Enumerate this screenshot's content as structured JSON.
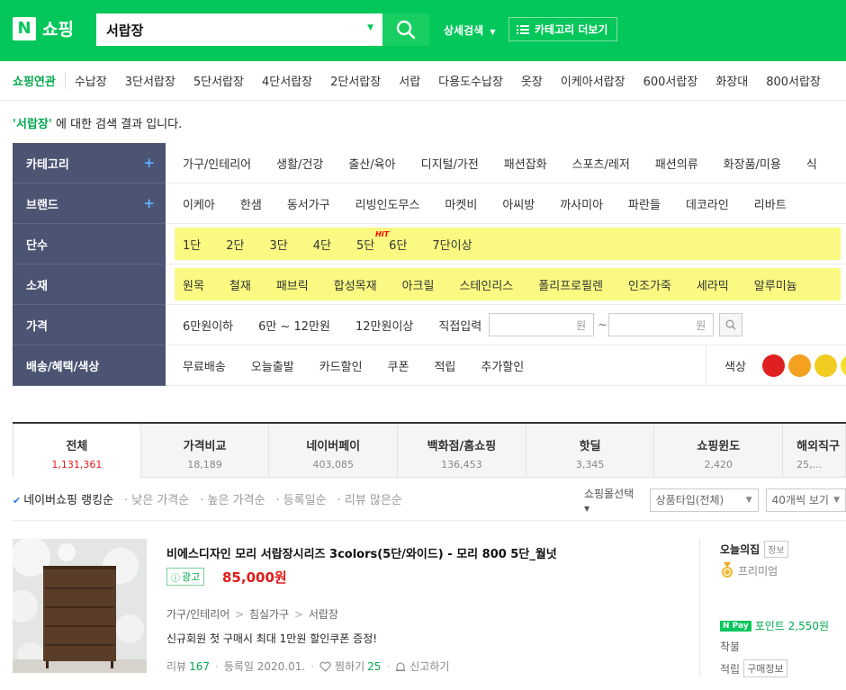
{
  "header": {
    "logo_letter": "N",
    "logo_text": "쇼핑",
    "search_value": "서랍장",
    "detail_search": "상세검색",
    "category_more": "카테고리 더보기"
  },
  "related": {
    "label": "쇼핑연관",
    "items": [
      "수납장",
      "3단서랍장",
      "5단서랍장",
      "4단서랍장",
      "2단서랍장",
      "서랍",
      "다용도수납장",
      "옷장",
      "이케아서랍장",
      "600서랍장",
      "화장대",
      "800서랍장"
    ]
  },
  "result": {
    "keyword": "'서랍장'",
    "suffix": " 에 대한 검색 결과 입니다."
  },
  "filters": {
    "category": {
      "label": "카테고리",
      "items": [
        "가구/인테리어",
        "생활/건강",
        "출산/육아",
        "디지털/가전",
        "패션잡화",
        "스포츠/레저",
        "패션의류",
        "화장품/미용",
        "식"
      ]
    },
    "brand": {
      "label": "브랜드",
      "items": [
        "이케아",
        "한샘",
        "동서가구",
        "리빙인도무스",
        "마켓비",
        "아씨방",
        "까사미아",
        "파란들",
        "데코라인",
        "리바트"
      ]
    },
    "tiers": {
      "label": "단수",
      "items": [
        "1단",
        "2단",
        "3단",
        "4단",
        "5단",
        "6단",
        "7단이상"
      ],
      "hit": "HIT"
    },
    "material": {
      "label": "소재",
      "items": [
        "원목",
        "철재",
        "패브릭",
        "합성목재",
        "아크릴",
        "스테인리스",
        "폴리프로필렌",
        "인조가죽",
        "세라믹",
        "알루미늄"
      ]
    },
    "price": {
      "label": "가격",
      "items": [
        "6만원이하",
        "6만 ~ 12만원",
        "12만원이상",
        "직접입력"
      ],
      "won": "원",
      "tilde": "~"
    },
    "shipping": {
      "label": "배송/혜택/색상",
      "items": [
        "무료배송",
        "오늘출발",
        "카드할인",
        "쿠폰",
        "적립",
        "추가할인"
      ],
      "color_label": "색상",
      "swatches": [
        "#e02020",
        "#f4a020",
        "#f0cc20",
        "#f5e030"
      ]
    }
  },
  "tabs": [
    {
      "name": "전체",
      "count": "1,131,361"
    },
    {
      "name": "가격비교",
      "count": "18,189"
    },
    {
      "name": "네이버페이",
      "count": "403,085"
    },
    {
      "name": "백화점/홈쇼핑",
      "count": "136,453"
    },
    {
      "name": "핫딜",
      "count": "3,345"
    },
    {
      "name": "쇼핑윈도",
      "count": "2,420"
    },
    {
      "name": "해외직구",
      "count": "25,..."
    }
  ],
  "sort": {
    "items": [
      "네이버쇼핑 랭킹순",
      "낮은 가격순",
      "높은 가격순",
      "등록일순",
      "리뷰 많은순"
    ],
    "mall_select": "쇼핑몰선택",
    "type_select": "상품타입(전체)",
    "per_page": "40개씩 보기"
  },
  "product": {
    "title": "비에스디자인 모리 서랍장시리즈 3colors(5단/와이드) - 모리 800 5단_월넛",
    "ad": "광고",
    "price": "85,000원",
    "categories": [
      "가구/인테리어",
      "침실가구",
      "서랍장"
    ],
    "desc": "신규회원 첫 구매시 최대 1만원 할인쿠폰 증정!",
    "review_label": "리뷰",
    "review_count": "167",
    "date": "등록일 2020.01.",
    "wish_label": "찜하기",
    "wish_count": "25",
    "report": "신고하기",
    "shop_name": "오늘의집",
    "shop_info": "정보",
    "premium": "프리미엄",
    "npay_badge": "N Pay",
    "npay_point": "포인트 2,550원",
    "shipping": "착불",
    "point_label": "적립",
    "point_box": "구매정보"
  }
}
